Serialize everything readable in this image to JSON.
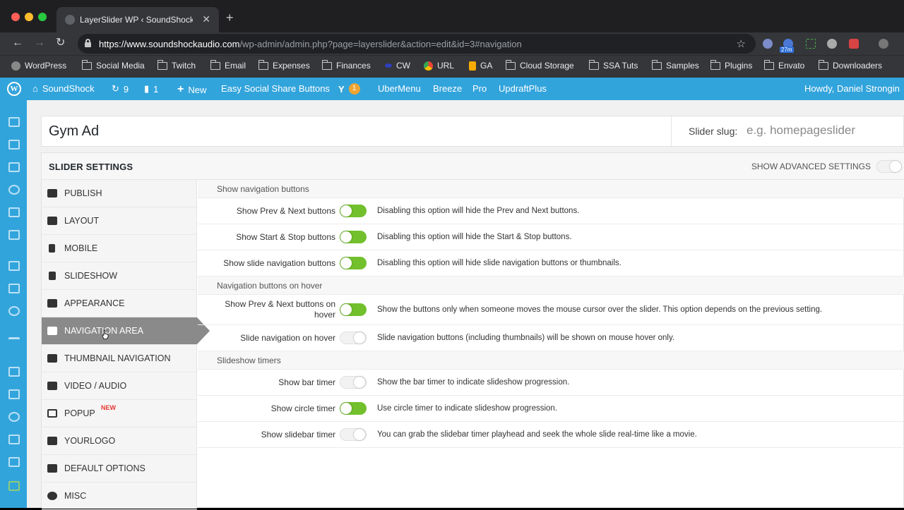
{
  "browser": {
    "tab_title": "LayerSlider WP ‹ SoundShock",
    "tab_close": "✕",
    "new_tab": "+",
    "url_host": "https://www.soundshockaudio.com",
    "url_path": "/wp-admin/admin.php?page=layerslider&action=edit&id=3#navigation",
    "extension_badge": "27m"
  },
  "bookmarks": [
    {
      "label": "WordPress",
      "icon": "wordpress-icon"
    },
    {
      "label": "Social Media",
      "icon": "folder-icon"
    },
    {
      "label": "Twitch",
      "icon": "folder-icon"
    },
    {
      "label": "Email",
      "icon": "folder-icon"
    },
    {
      "label": "Expenses",
      "icon": "folder-icon"
    },
    {
      "label": "Finances",
      "icon": "folder-icon"
    },
    {
      "label": "CW",
      "icon": "cw-icon"
    },
    {
      "label": "URL",
      "icon": "chrome-icon"
    },
    {
      "label": "GA",
      "icon": "analytics-icon"
    },
    {
      "label": "Cloud Storage",
      "icon": "folder-icon"
    },
    {
      "label": "SSA Tuts",
      "icon": "folder-icon"
    },
    {
      "label": "Samples",
      "icon": "folder-icon"
    },
    {
      "label": "Plugins",
      "icon": "folder-icon"
    },
    {
      "label": "Envato",
      "icon": "folder-icon"
    },
    {
      "label": "Downloaders",
      "icon": "folder-icon"
    }
  ],
  "adminbar": {
    "site_name": "SoundShock",
    "updates_count": "9",
    "comments_count": "1",
    "new_label": "New",
    "social_share": "Easy Social Share Buttons",
    "yoast_count": "1",
    "ubermenu": "UberMenu",
    "breeze": "Breeze",
    "pro": "Pro",
    "updraft": "UpdraftPlus",
    "howdy": "Howdy, Daniel Strongin"
  },
  "editor": {
    "slider_title": "Gym Ad",
    "slug_label": "Slider slug:",
    "slug_placeholder": "e.g. homepageslider"
  },
  "panel": {
    "title": "SLIDER SETTINGS",
    "advanced_label": "SHOW ADVANCED SETTINGS"
  },
  "nav": [
    {
      "label": "PUBLISH"
    },
    {
      "label": "LAYOUT"
    },
    {
      "label": "MOBILE"
    },
    {
      "label": "SLIDESHOW"
    },
    {
      "label": "APPEARANCE"
    },
    {
      "label": "NAVIGATION AREA",
      "active": true
    },
    {
      "label": "THUMBNAIL NAVIGATION"
    },
    {
      "label": "VIDEO / AUDIO"
    },
    {
      "label": "POPUP",
      "badge": "NEW"
    },
    {
      "label": "YOURLOGO"
    },
    {
      "label": "DEFAULT OPTIONS"
    },
    {
      "label": "MISC"
    }
  ],
  "sections": {
    "show_nav": "Show navigation buttons",
    "hover": "Navigation buttons on hover",
    "timers": "Slideshow timers"
  },
  "settings": [
    {
      "label": "Show Prev & Next buttons",
      "on": true,
      "desc": "Disabling this option will hide the Prev and Next buttons."
    },
    {
      "label": "Show Start & Stop buttons",
      "on": true,
      "desc": "Disabling this option will hide the Start & Stop buttons."
    },
    {
      "label": "Show slide navigation buttons",
      "on": true,
      "desc": "Disabling this option will hide slide navigation buttons or thumbnails."
    },
    {
      "label": "Show Prev & Next buttons on hover",
      "on": true,
      "desc": "Show the buttons only when someone moves the mouse cursor over the slider. This option depends on the previous setting."
    },
    {
      "label": "Slide navigation on hover",
      "on": false,
      "desc": "Slide navigation buttons (including thumbnails) will be shown on mouse hover only."
    },
    {
      "label": "Show bar timer",
      "on": false,
      "desc": "Show the bar timer to indicate slideshow progression."
    },
    {
      "label": "Show circle timer",
      "on": true,
      "desc": "Use circle timer to indicate slideshow progression."
    },
    {
      "label": "Show slidebar timer",
      "on": false,
      "desc": "You can grab the slidebar timer playhead and seek the whole slide real-time like a movie."
    }
  ],
  "colors": {
    "toggle_on": "#72c02c",
    "admin_bar": "#32a4dc",
    "active_nav": "#8a8a8a"
  }
}
